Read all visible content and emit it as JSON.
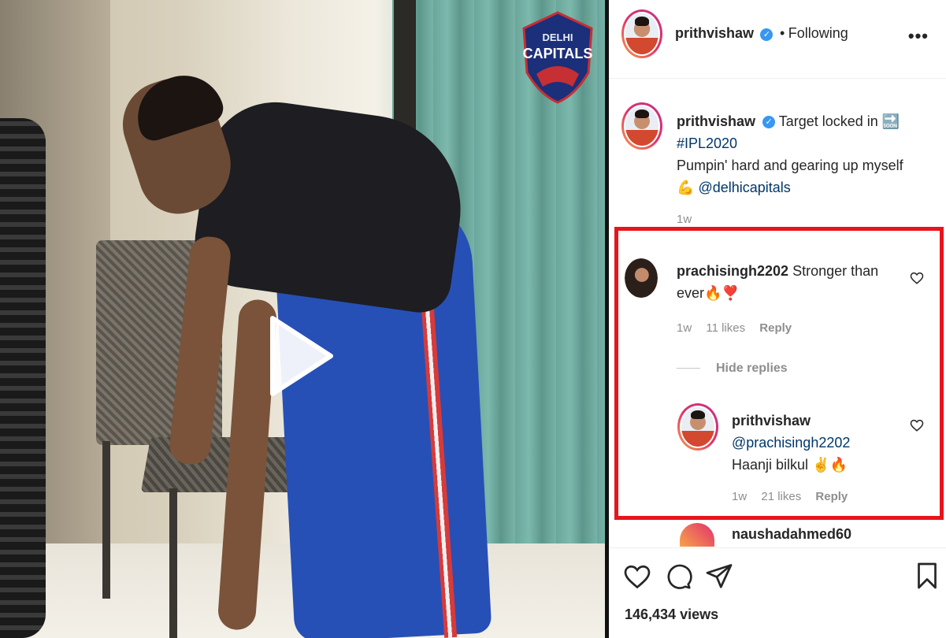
{
  "media": {
    "logo_line1": "DELHI",
    "logo_line2": "CAPITALS"
  },
  "post": {
    "author": "prithvishaw",
    "follow_separator": "•",
    "follow_status": "Following"
  },
  "caption": {
    "author": "prithvishaw",
    "text_part1": "Target locked in",
    "emoji_box": "🔜",
    "hashtag": "#IPL2020",
    "line2": "Pumpin' hard and gearing up myself",
    "emoji_muscle": "💪",
    "mention": "@delhicapitals",
    "time": "1w"
  },
  "comments": [
    {
      "author": "prachisingh2202",
      "text": "Stronger than ever🔥❣️",
      "time": "1w",
      "likes": "11 likes",
      "reply_label": "Reply"
    }
  ],
  "hide_replies_label": "Hide replies",
  "reply": {
    "author": "prithvishaw",
    "mention": "@prachisingh2202",
    "text": "Haanji bilkul ✌️🔥",
    "time": "1w",
    "likes": "21 likes",
    "reply_label": "Reply"
  },
  "next_comment": {
    "author": "naushadahmed60"
  },
  "footer": {
    "views": "146,434 views"
  },
  "colors": {
    "highlight_border": "#e8141c",
    "verified_badge": "#3897f0",
    "link": "#00376b",
    "muted": "#8e8e8e"
  },
  "icons": [
    "more-icon",
    "verified-icon",
    "heart-icon",
    "comment-icon",
    "share-icon",
    "bookmark-icon",
    "play-icon"
  ]
}
